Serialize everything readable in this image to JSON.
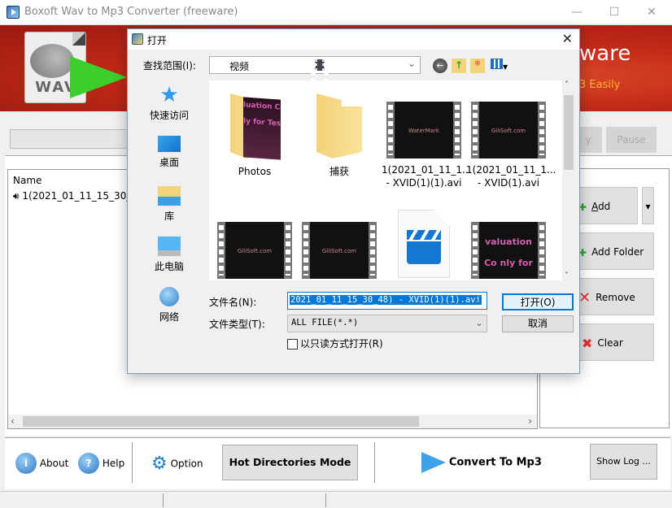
{
  "window": {
    "title": "Boxoft Wav to Mp3 Converter (freeware)",
    "minimize": "—",
    "maximize": "☐",
    "close": "✕"
  },
  "banner": {
    "brand_partial": "ware",
    "tagline_partial": "3 Easily",
    "wav_label": "WAV"
  },
  "controls": {
    "play_partial": "y",
    "pause": "Pause"
  },
  "file_list": {
    "column_name": "Name",
    "items": [
      {
        "name": "1(2021_01_11_15_30_..."
      }
    ]
  },
  "side_buttons": {
    "add": "Add",
    "add_mnemonic": "A",
    "add_dropdown": "▾",
    "add_folder": "Add Folder",
    "remove": "Remove",
    "clear": "Clear"
  },
  "bottom_toolbar": {
    "about": "About",
    "help": "Help",
    "option": "Option",
    "hot_directories": "Hot Directories Mode",
    "convert": "Convert To Mp3",
    "show_log": "Show Log ..."
  },
  "dialog": {
    "title": "打开",
    "close": "✕",
    "look_in_label": "查找范围(I):",
    "look_in_value": "视频",
    "places": [
      {
        "label": "快速访问",
        "icon": "star-icon"
      },
      {
        "label": "桌面",
        "icon": "desktop-icon"
      },
      {
        "label": "库",
        "icon": "library-icon"
      },
      {
        "label": "此电脑",
        "icon": "computer-icon"
      },
      {
        "label": "网络",
        "icon": "network-icon"
      }
    ],
    "files": [
      {
        "name": "Photos",
        "type": "folder-preview"
      },
      {
        "name": "捕获",
        "type": "folder"
      },
      {
        "name": "1(2021_01_11_1... - XVID(1)(1).avi",
        "line1": "1(2021_01_11_1...",
        "line2": "- XVID(1)(1).avi",
        "type": "video",
        "watermark": "WaterMark"
      },
      {
        "name": "1(2021_01_11_1... - XVID(1).avi",
        "line1": "1(2021_01_11_1...",
        "line2": "- XVID(1).avi",
        "type": "video",
        "watermark": "GiliSoft.com"
      },
      {
        "name": "",
        "type": "video",
        "watermark": "GiliSoft.com"
      },
      {
        "name": "",
        "type": "video",
        "watermark": "GiliSoft.com"
      },
      {
        "name": "",
        "type": "media-file"
      },
      {
        "name": "",
        "type": "video-eval",
        "watermark": "valuation Co nly for Testi"
      }
    ],
    "folder_preview_text": "luation Co\nly for Testi",
    "file_name_label": "文件名(N):",
    "file_name_value": "2021_01_11_15_30_48) - XVID(1)(1).avi",
    "file_type_label": "文件类型(T):",
    "file_type_value": "ALL FILE(*.*)",
    "readonly_label": "以只读方式打开(R)",
    "open_button": "打开(O)",
    "cancel_button": "取消"
  },
  "colors": {
    "banner_red": "#c42a18",
    "accent_blue": "#0078d7",
    "tagline_orange": "#ffb52a"
  }
}
